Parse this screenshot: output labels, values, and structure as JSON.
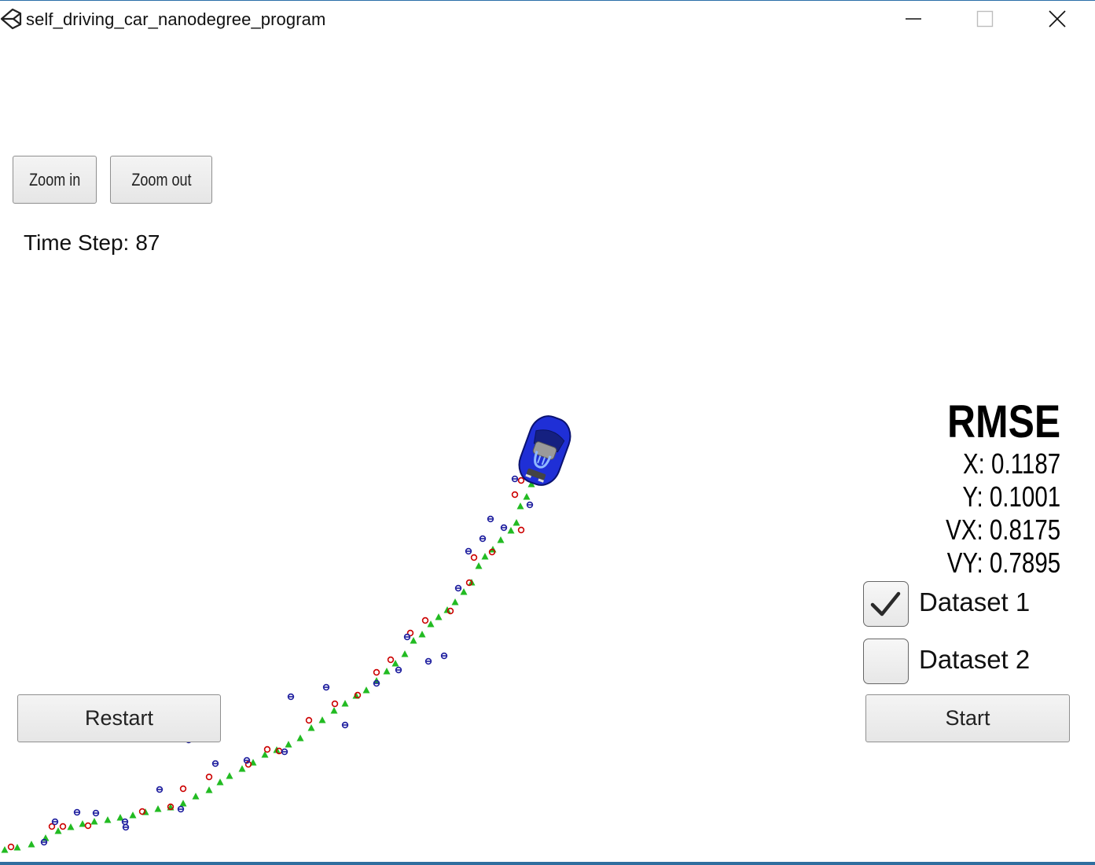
{
  "window": {
    "title": "self_driving_car_nanodegree_program"
  },
  "controls": {
    "zoom_in": "Zoom in",
    "zoom_out": "Zoom out",
    "restart": "Restart",
    "start": "Start"
  },
  "time_step": {
    "label": "Time Step:",
    "value": "87"
  },
  "rmse": {
    "title": "RMSE",
    "x_label": "X:",
    "x_value": "0.1187",
    "y_label": "Y:",
    "y_value": "0.1001",
    "vx_label": "VX:",
    "vx_value": "0.8175",
    "vy_label": "VY:",
    "vy_value": "0.7895"
  },
  "datasets": [
    {
      "label": "Dataset 1",
      "checked": true
    },
    {
      "label": "Dataset 2",
      "checked": false
    }
  ],
  "colors": {
    "lidar_marker": "#cc0000",
    "radar_marker": "#1f1f9f",
    "estimate_marker": "#22bb22",
    "car_body": "#1f2fd6"
  },
  "icons": {
    "app": "unity-logo-icon",
    "minimize": "minimize-icon",
    "maximize": "maximize-icon",
    "close": "close-icon",
    "car": "car-icon"
  }
}
